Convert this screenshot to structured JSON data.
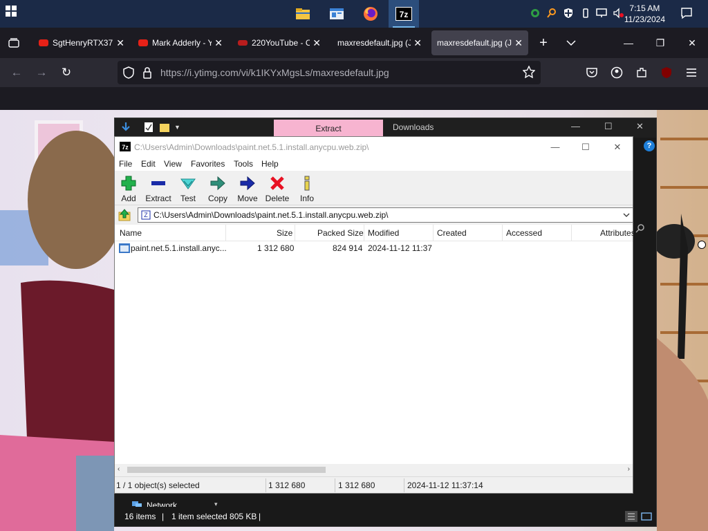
{
  "taskbar": {
    "apps": [
      "file-explorer",
      "control-panel",
      "firefox",
      "7-zip"
    ],
    "active_app": "7-zip",
    "clock": {
      "time": "7:15 AM",
      "date": "11/23/2024"
    }
  },
  "browser": {
    "tabs": [
      {
        "title": "SgtHenryRTX37",
        "favicon_color": "#e62117",
        "selected": false
      },
      {
        "title": "Mark Adderly - Y",
        "favicon_color": "#e62117",
        "selected": false
      },
      {
        "title": "220YouTube - Co",
        "favicon_color": "#b81d1d",
        "selected": false
      },
      {
        "title": "maxresdefault.jpg (J",
        "favicon_color": "",
        "selected": false
      },
      {
        "title": "maxresdefault.jpg (J",
        "favicon_color": "",
        "selected": true
      }
    ],
    "url": "https://i.ytimg.com/vi/k1IKYxMgsLs/maxresdefault.jpg"
  },
  "explorer": {
    "ribbon_tab": "Extract",
    "title": "Downloads",
    "nav_item": "Network",
    "status": {
      "items": "16 items",
      "selected": "1 item selected  805 KB"
    }
  },
  "sevenzip": {
    "title": "C:\\Users\\Admin\\Downloads\\paint.net.5.1.install.anycpu.web.zip\\",
    "menu": [
      "File",
      "Edit",
      "View",
      "Favorites",
      "Tools",
      "Help"
    ],
    "toolbar": [
      {
        "label": "Add",
        "icon": "add-icon"
      },
      {
        "label": "Extract",
        "icon": "extract-icon"
      },
      {
        "label": "Test",
        "icon": "test-icon"
      },
      {
        "label": "Copy",
        "icon": "copy-icon"
      },
      {
        "label": "Move",
        "icon": "move-icon"
      },
      {
        "label": "Delete",
        "icon": "delete-icon"
      },
      {
        "label": "Info",
        "icon": "info-icon"
      }
    ],
    "address": "C:\\Users\\Admin\\Downloads\\paint.net.5.1.install.anycpu.web.zip\\",
    "columns": [
      "Name",
      "Size",
      "Packed Size",
      "Modified",
      "Created",
      "Accessed",
      "Attributes"
    ],
    "rows": [
      {
        "name": "paint.net.5.1.install.anyc...",
        "size": "1 312 680",
        "packed": "824 914",
        "modified": "2024-11-12 11:37",
        "created": "",
        "accessed": "",
        "attributes": ""
      }
    ],
    "status": {
      "selection": "1 / 1 object(s) selected",
      "size": "1 312 680",
      "packed": "1 312 680",
      "modified": "2024-11-12 11:37:14"
    }
  },
  "colors": {
    "taskbar": "#1b2a47",
    "firefox_chrome": "#2b2a33",
    "extract_tab": "#f7b4d0",
    "add_green": "#22b14c",
    "extract_blue": "#1a2ca8",
    "delete_red": "#e81123"
  }
}
